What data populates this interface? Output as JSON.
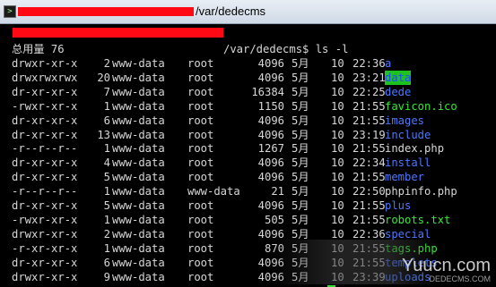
{
  "window": {
    "title_path": "/var/dedecms"
  },
  "terminal": {
    "prompt_suffix": "/var/dedecms$ ls -l",
    "total_line": "总用量 76",
    "columns": [
      "perms",
      "links",
      "owner",
      "group",
      "size",
      "month",
      "day",
      "time",
      "name"
    ],
    "rows": [
      {
        "perms": "drwxr-xr-x",
        "links": "2",
        "owner": "www-data",
        "group": "root",
        "size": "4096",
        "month": "5月",
        "day": "10",
        "time": "22:36",
        "name": "a",
        "style": "blue"
      },
      {
        "perms": "drwxrwxrwx",
        "links": "20",
        "owner": "www-data",
        "group": "root",
        "size": "4096",
        "month": "5月",
        "day": "10",
        "time": "23:21",
        "name": "data",
        "style": "hl"
      },
      {
        "perms": "dr-xr-xr-x",
        "links": "7",
        "owner": "www-data",
        "group": "root",
        "size": "16384",
        "month": "5月",
        "day": "10",
        "time": "22:25",
        "name": "dede",
        "style": "blue"
      },
      {
        "perms": "-rwxr-xr-x",
        "links": "1",
        "owner": "www-data",
        "group": "root",
        "size": "1150",
        "month": "5月",
        "day": "10",
        "time": "21:55",
        "name": "favicon.ico",
        "style": "green"
      },
      {
        "perms": "dr-xr-xr-x",
        "links": "6",
        "owner": "www-data",
        "group": "root",
        "size": "4096",
        "month": "5月",
        "day": "10",
        "time": "21:55",
        "name": "images",
        "style": "blue"
      },
      {
        "perms": "dr-xr-xr-x",
        "links": "13",
        "owner": "www-data",
        "group": "root",
        "size": "4096",
        "month": "5月",
        "day": "10",
        "time": "23:19",
        "name": "include",
        "style": "blue"
      },
      {
        "perms": "-r--r--r--",
        "links": "1",
        "owner": "www-data",
        "group": "root",
        "size": "1267",
        "month": "5月",
        "day": "10",
        "time": "21:55",
        "name": "index.php",
        "style": "gray"
      },
      {
        "perms": "dr-xr-xr-x",
        "links": "4",
        "owner": "www-data",
        "group": "root",
        "size": "4096",
        "month": "5月",
        "day": "10",
        "time": "22:34",
        "name": "install",
        "style": "blue"
      },
      {
        "perms": "dr-xr-xr-x",
        "links": "5",
        "owner": "www-data",
        "group": "root",
        "size": "4096",
        "month": "5月",
        "day": "10",
        "time": "21:55",
        "name": "member",
        "style": "blue"
      },
      {
        "perms": "-r--r--r--",
        "links": "1",
        "owner": "www-data",
        "group": "www-data",
        "size": "21",
        "month": "5月",
        "day": "10",
        "time": "22:50",
        "name": "phpinfo.php",
        "style": "gray"
      },
      {
        "perms": "dr-xr-xr-x",
        "links": "5",
        "owner": "www-data",
        "group": "root",
        "size": "4096",
        "month": "5月",
        "day": "10",
        "time": "21:55",
        "name": "plus",
        "style": "blue"
      },
      {
        "perms": "-rwxr-xr-x",
        "links": "1",
        "owner": "www-data",
        "group": "root",
        "size": "505",
        "month": "5月",
        "day": "10",
        "time": "21:55",
        "name": "robots.txt",
        "style": "green"
      },
      {
        "perms": "drwxr-xr-x",
        "links": "2",
        "owner": "www-data",
        "group": "root",
        "size": "4096",
        "month": "5月",
        "day": "10",
        "time": "22:36",
        "name": "special",
        "style": "blue"
      },
      {
        "perms": "-r-xr-xr-x",
        "links": "1",
        "owner": "www-data",
        "group": "root",
        "size": "870",
        "month": "5月",
        "day": "10",
        "time": "21:55",
        "name": "tags.php",
        "style": "green"
      },
      {
        "perms": "dr-xr-xr-x",
        "links": "6",
        "owner": "www-data",
        "group": "root",
        "size": "4096",
        "month": "5月",
        "day": "10",
        "time": "21:55",
        "name": "templets",
        "style": "blue"
      },
      {
        "perms": "drwxr-xr-x",
        "links": "9",
        "owner": "www-data",
        "group": "root",
        "size": "4096",
        "month": "5月",
        "day": "10",
        "time": "23:39",
        "name": "uploads",
        "style": "blue"
      }
    ]
  },
  "watermark": {
    "text": "Yuucn.com",
    "subtext": "DEDECMS.COM"
  },
  "colors": {
    "directory": "#4c78ff",
    "executable": "#37e637",
    "highlight_bg": "#1ec21e",
    "redaction": "#ff0a14"
  }
}
